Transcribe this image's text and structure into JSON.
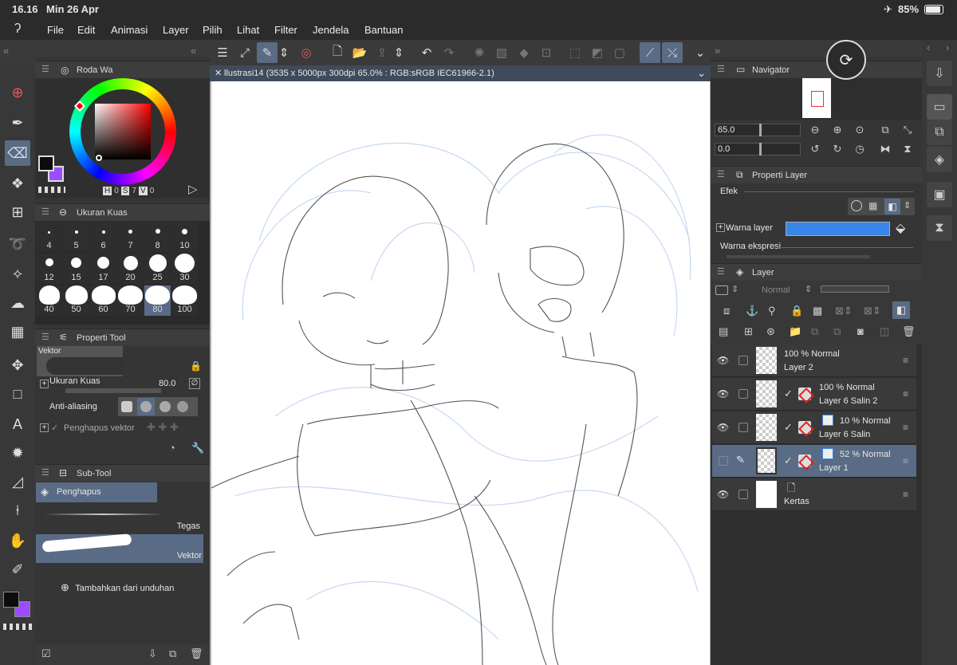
{
  "status": {
    "time": "16.16",
    "date": "Min 26 Apr",
    "battery": "85%"
  },
  "menu": [
    "File",
    "Edit",
    "Animasi",
    "Layer",
    "Pilih",
    "Lihat",
    "Filter",
    "Jendela",
    "Bantuan"
  ],
  "document_tab": "llustrasi14 (3535 x 5000px 300dpi 65.0% : RGB:sRGB IEC61966-2.1)",
  "color_panel": {
    "title": "Roda Wa",
    "h_label": "H",
    "h_value": "0",
    "s_label": "S",
    "s_value": "7",
    "v_label": "V",
    "v_value": "0",
    "main_color": "#0c0c0c",
    "sub_color": "#9b4dff"
  },
  "brush_size_panel": {
    "title": "Ukuran Kuas",
    "sizes": [
      "4",
      "5",
      "6",
      "7",
      "8",
      "10",
      "12",
      "15",
      "17",
      "20",
      "25",
      "30",
      "40",
      "50",
      "60",
      "70",
      "80",
      "100"
    ]
  },
  "tool_property": {
    "title": "Properti Tool",
    "preview_label": "Vektor",
    "brush_size_label": "Ukuran Kuas",
    "brush_size_value": "80.0",
    "antialias_label": "Anti-aliasing",
    "vector_eraser_label": "Penghapus vektor"
  },
  "sub_tool": {
    "title": "Sub-Tool",
    "group": "Penghapus",
    "items": [
      "Tegas",
      "Vektor"
    ],
    "add_label": "Tambahkan dari unduhan"
  },
  "navigator": {
    "title": "Navigator",
    "zoom": "65.0",
    "rotation": "0.0"
  },
  "layer_property": {
    "title": "Properti Layer",
    "effect_label": "Efek",
    "layer_color_label": "Warna layer",
    "layer_color": "#3a86e8",
    "expression_color_label": "Warna ekspresi"
  },
  "layer_panel": {
    "title": "Layer",
    "blend_mode": "Normal",
    "layers": [
      {
        "opacity": "100 %",
        "mode": "Normal",
        "name": "Layer 2"
      },
      {
        "opacity": "100 %",
        "mode": "Normal",
        "name": "Layer 6 Salin 2"
      },
      {
        "opacity": "10 %",
        "mode": "Normal",
        "name": "Layer 6 Salin"
      },
      {
        "opacity": "52 %",
        "mode": "Normal",
        "name": "Layer 1"
      },
      {
        "opacity": "",
        "mode": "",
        "name": "Kertas"
      }
    ]
  },
  "accent_color": "#5a6b85"
}
